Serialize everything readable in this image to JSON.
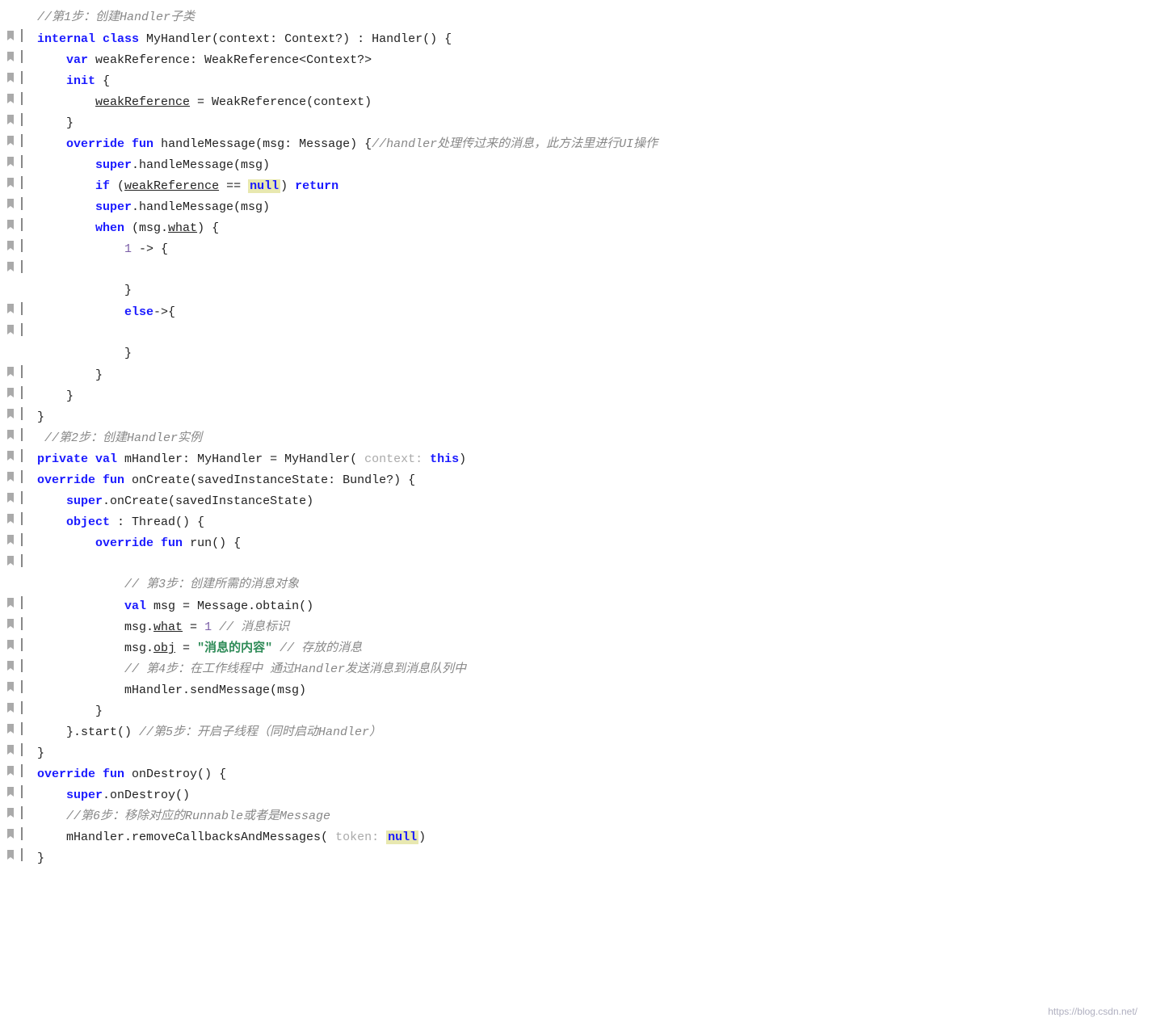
{
  "watermark": "https://blog.csdn.net/",
  "lines": [
    {
      "gutter": "",
      "tokens": [
        {
          "t": "comment",
          "v": "//第1步：创建Handler子类"
        }
      ]
    },
    {
      "gutter": "",
      "tokens": [
        {
          "t": "kw",
          "v": "internal"
        },
        {
          "t": "plain",
          "v": " "
        },
        {
          "t": "kw",
          "v": "class"
        },
        {
          "t": "plain",
          "v": " MyHandler(context: Context?) : Handler() {"
        }
      ]
    },
    {
      "gutter": "",
      "tokens": [
        {
          "t": "plain",
          "v": "    "
        },
        {
          "t": "kw",
          "v": "var"
        },
        {
          "t": "plain",
          "v": " weakReference: WeakReference<Context?>"
        }
      ]
    },
    {
      "gutter": "",
      "tokens": [
        {
          "t": "plain",
          "v": "    "
        },
        {
          "t": "kw",
          "v": "init"
        },
        {
          "t": "plain",
          "v": " {"
        }
      ]
    },
    {
      "gutter": "",
      "tokens": [
        {
          "t": "plain",
          "v": "        "
        },
        {
          "t": "underline",
          "v": "weakReference"
        },
        {
          "t": "plain",
          "v": " = WeakReference(context)"
        }
      ]
    },
    {
      "gutter": "",
      "tokens": [
        {
          "t": "plain",
          "v": "    }"
        }
      ]
    },
    {
      "gutter": "",
      "tokens": [
        {
          "t": "plain",
          "v": "    "
        },
        {
          "t": "kw",
          "v": "override"
        },
        {
          "t": "plain",
          "v": " "
        },
        {
          "t": "kw",
          "v": "fun"
        },
        {
          "t": "plain",
          "v": " handleMessage(msg: Message) {"
        },
        {
          "t": "comment",
          "v": "//handler处理传过来的消息，此方法里进行UI操作"
        }
      ]
    },
    {
      "gutter": "",
      "tokens": [
        {
          "t": "plain",
          "v": "        "
        },
        {
          "t": "super",
          "v": "super"
        },
        {
          "t": "plain",
          "v": ".handleMessage(msg)"
        }
      ]
    },
    {
      "gutter": "",
      "tokens": [
        {
          "t": "plain",
          "v": "        "
        },
        {
          "t": "kw",
          "v": "if"
        },
        {
          "t": "plain",
          "v": " ("
        },
        {
          "t": "underline",
          "v": "weakReference"
        },
        {
          "t": "plain",
          "v": " == "
        },
        {
          "t": "null",
          "v": "null"
        },
        {
          "t": "plain",
          "v": ") "
        },
        {
          "t": "kw",
          "v": "return"
        }
      ]
    },
    {
      "gutter": "",
      "tokens": [
        {
          "t": "plain",
          "v": "        "
        },
        {
          "t": "super",
          "v": "super"
        },
        {
          "t": "plain",
          "v": ".handleMessage(msg)"
        }
      ]
    },
    {
      "gutter": "",
      "tokens": [
        {
          "t": "plain",
          "v": "        "
        },
        {
          "t": "kw",
          "v": "when"
        },
        {
          "t": "plain",
          "v": " (msg."
        },
        {
          "t": "underline",
          "v": "what"
        },
        {
          "t": "plain",
          "v": ") {"
        }
      ]
    },
    {
      "gutter": "",
      "tokens": [
        {
          "t": "plain",
          "v": "            "
        },
        {
          "t": "number",
          "v": "1"
        },
        {
          "t": "plain",
          "v": " -> {"
        }
      ]
    },
    {
      "gutter": "",
      "tokens": [
        {
          "t": "plain",
          "v": ""
        }
      ]
    },
    {
      "gutter": "",
      "tokens": [
        {
          "t": "plain",
          "v": "            }"
        }
      ]
    },
    {
      "gutter": "",
      "tokens": [
        {
          "t": "plain",
          "v": "            "
        },
        {
          "t": "kw",
          "v": "else"
        },
        {
          "t": "plain",
          "v": "->{"
        }
      ]
    },
    {
      "gutter": "",
      "tokens": [
        {
          "t": "plain",
          "v": ""
        }
      ]
    },
    {
      "gutter": "",
      "tokens": [
        {
          "t": "plain",
          "v": "            }"
        }
      ]
    },
    {
      "gutter": "",
      "tokens": [
        {
          "t": "plain",
          "v": "        }"
        }
      ]
    },
    {
      "gutter": "",
      "tokens": [
        {
          "t": "plain",
          "v": "    }"
        }
      ]
    },
    {
      "gutter": "",
      "tokens": [
        {
          "t": "plain",
          "v": "}"
        }
      ]
    },
    {
      "gutter": "",
      "tokens": [
        {
          "t": "comment-step",
          "v": " //第2步：创建Handler实例"
        }
      ]
    },
    {
      "gutter": "",
      "tokens": [
        {
          "t": "kw",
          "v": "private"
        },
        {
          "t": "plain",
          "v": " "
        },
        {
          "t": "kw",
          "v": "val"
        },
        {
          "t": "plain",
          "v": " mHandler: MyHandler = MyHandler( "
        },
        {
          "t": "param-label",
          "v": "context:"
        },
        {
          "t": "plain",
          "v": " "
        },
        {
          "t": "kw",
          "v": "this"
        },
        {
          "t": "plain",
          "v": ")"
        }
      ]
    },
    {
      "gutter": "",
      "tokens": [
        {
          "t": "kw",
          "v": "override"
        },
        {
          "t": "plain",
          "v": " "
        },
        {
          "t": "kw",
          "v": "fun"
        },
        {
          "t": "plain",
          "v": " onCreate(savedInstanceState: Bundle?) {"
        }
      ]
    },
    {
      "gutter": "",
      "tokens": [
        {
          "t": "plain",
          "v": "    "
        },
        {
          "t": "super",
          "v": "super"
        },
        {
          "t": "plain",
          "v": ".onCreate(savedInstanceState)"
        }
      ]
    },
    {
      "gutter": "",
      "tokens": [
        {
          "t": "plain",
          "v": "    "
        },
        {
          "t": "kw",
          "v": "object"
        },
        {
          "t": "plain",
          "v": " : Thread() {"
        }
      ]
    },
    {
      "gutter": "",
      "tokens": [
        {
          "t": "plain",
          "v": "        "
        },
        {
          "t": "kw",
          "v": "override"
        },
        {
          "t": "plain",
          "v": " "
        },
        {
          "t": "kw",
          "v": "fun"
        },
        {
          "t": "plain",
          "v": " run() {"
        }
      ]
    },
    {
      "gutter": "",
      "tokens": [
        {
          "t": "plain",
          "v": ""
        }
      ]
    },
    {
      "gutter": "",
      "tokens": [
        {
          "t": "plain",
          "v": "            "
        },
        {
          "t": "comment",
          "v": "// 第3步：创建所需的消息对象"
        }
      ]
    },
    {
      "gutter": "",
      "tokens": [
        {
          "t": "plain",
          "v": "            "
        },
        {
          "t": "kw",
          "v": "val"
        },
        {
          "t": "plain",
          "v": " msg = Message.obtain()"
        }
      ]
    },
    {
      "gutter": "",
      "tokens": [
        {
          "t": "plain",
          "v": "            msg."
        },
        {
          "t": "underline",
          "v": "what"
        },
        {
          "t": "plain",
          "v": " = "
        },
        {
          "t": "number",
          "v": "1"
        },
        {
          "t": "plain",
          "v": " "
        },
        {
          "t": "comment",
          "v": "// 消息标识"
        }
      ]
    },
    {
      "gutter": "",
      "tokens": [
        {
          "t": "plain",
          "v": "            msg."
        },
        {
          "t": "underline",
          "v": "obj"
        },
        {
          "t": "plain",
          "v": " = "
        },
        {
          "t": "string",
          "v": "\"消息的内容\""
        },
        {
          "t": "plain",
          "v": " "
        },
        {
          "t": "comment",
          "v": "// 存放的消息"
        }
      ]
    },
    {
      "gutter": "",
      "tokens": [
        {
          "t": "plain",
          "v": "            "
        },
        {
          "t": "comment",
          "v": "// 第4步：在工作线程中 通过Handler发送消息到消息队列中"
        }
      ]
    },
    {
      "gutter": "",
      "tokens": [
        {
          "t": "plain",
          "v": "            mHandler.sendMessage(msg)"
        }
      ]
    },
    {
      "gutter": "",
      "tokens": [
        {
          "t": "plain",
          "v": "        }"
        }
      ]
    },
    {
      "gutter": "",
      "tokens": [
        {
          "t": "plain",
          "v": "    }.start() "
        },
        {
          "t": "comment",
          "v": "//第5步：开启子线程（同时启动Handler）"
        }
      ]
    },
    {
      "gutter": "",
      "tokens": [
        {
          "t": "plain",
          "v": "}"
        }
      ]
    },
    {
      "gutter": "",
      "tokens": [
        {
          "t": "kw",
          "v": "override"
        },
        {
          "t": "plain",
          "v": " "
        },
        {
          "t": "kw",
          "v": "fun"
        },
        {
          "t": "plain",
          "v": " onDestroy() {"
        }
      ]
    },
    {
      "gutter": "",
      "tokens": [
        {
          "t": "plain",
          "v": "    "
        },
        {
          "t": "super",
          "v": "super"
        },
        {
          "t": "plain",
          "v": ".onDestroy()"
        }
      ]
    },
    {
      "gutter": "",
      "tokens": [
        {
          "t": "plain",
          "v": "    "
        },
        {
          "t": "comment",
          "v": "//第6步：移除对应的Runnable或者是Message"
        }
      ]
    },
    {
      "gutter": "",
      "tokens": [
        {
          "t": "plain",
          "v": "    mHandler.removeCallbacksAndMessages( "
        },
        {
          "t": "param-label",
          "v": "token:"
        },
        {
          "t": "plain",
          "v": " "
        },
        {
          "t": "null",
          "v": "null"
        },
        {
          "t": "plain",
          "v": ")"
        }
      ]
    },
    {
      "gutter": "",
      "tokens": [
        {
          "t": "plain",
          "v": "}"
        }
      ]
    }
  ]
}
